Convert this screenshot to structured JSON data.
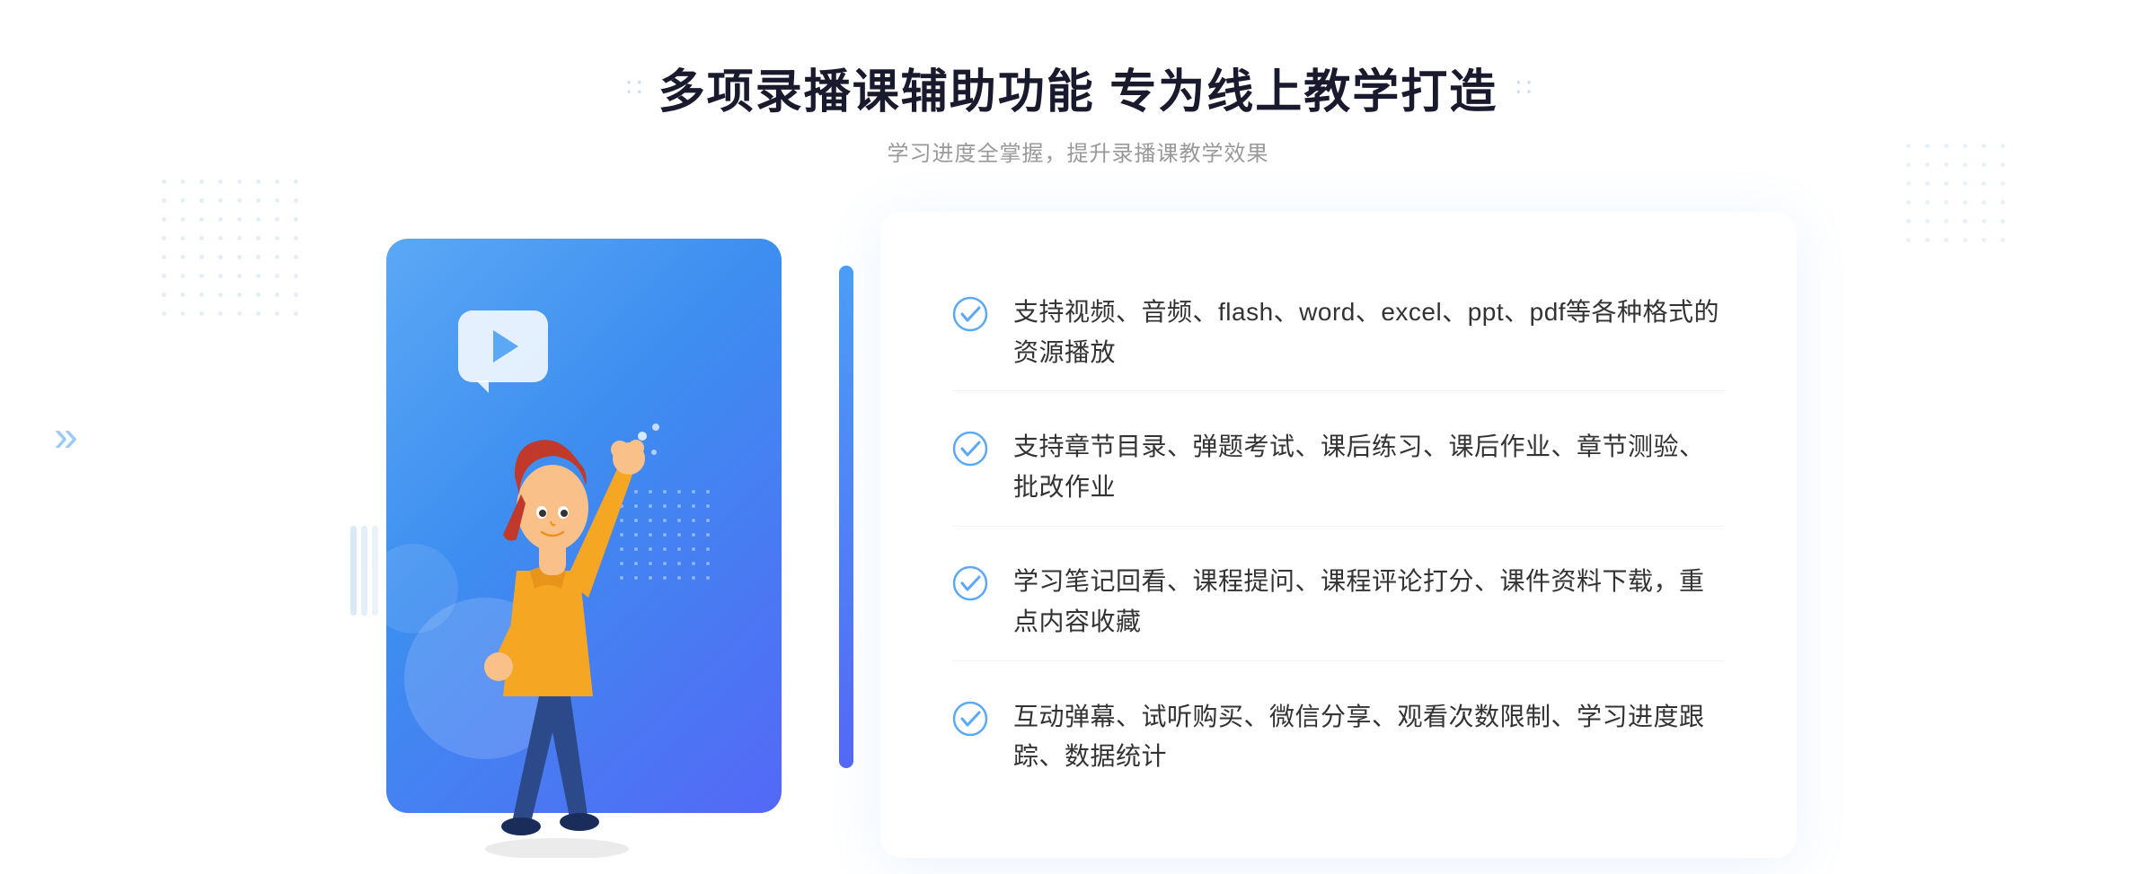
{
  "header": {
    "title": "多项录播课辅助功能 专为线上教学打造",
    "subtitle": "学习进度全掌握，提升录播课教学效果",
    "left_decorator": "∷",
    "right_decorator": "∷"
  },
  "features": [
    {
      "id": 1,
      "text": "支持视频、音频、flash、word、excel、ppt、pdf等各种格式的资源播放"
    },
    {
      "id": 2,
      "text": "支持章节目录、弹题考试、课后练习、课后作业、章节测验、批改作业"
    },
    {
      "id": 3,
      "text": "学习笔记回看、课程提问、课程评论打分、课件资料下载，重点内容收藏"
    },
    {
      "id": 4,
      "text": "互动弹幕、试听购买、微信分享、观看次数限制、学习进度跟踪、数据统计"
    }
  ],
  "arrow_left": "»",
  "colors": {
    "primary_blue": "#4a9fe8",
    "gradient_start": "#5ba8f5",
    "gradient_end": "#5468f5",
    "text_dark": "#1a1a2e",
    "text_gray": "#999999",
    "text_normal": "#333333",
    "check_color": "#5ba8f5"
  }
}
